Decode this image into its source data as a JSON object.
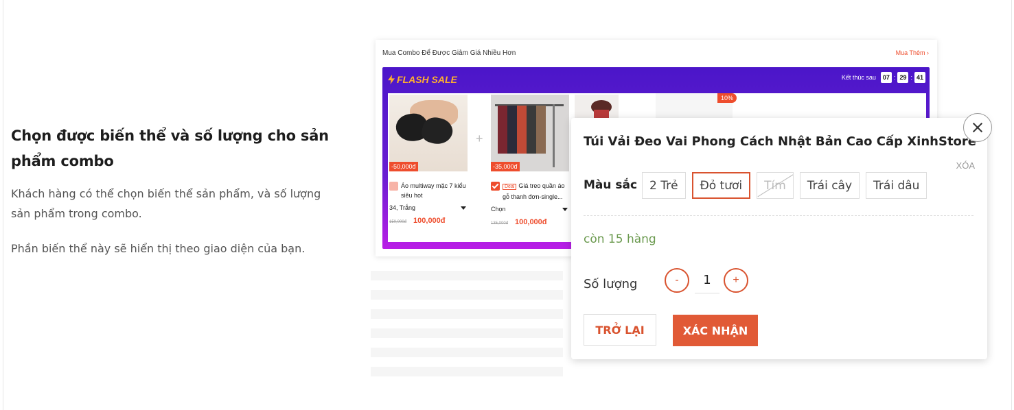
{
  "left": {
    "heading": "Chọn được biến thể và số lượng cho sản phẩm combo",
    "para1": "Khách hàng có thể chọn biến thể sản phẩm, và số lượng sản phẩm trong combo.",
    "para2": "Phần biến thể này sẽ hiển thị theo giao diện của bạn."
  },
  "combo": {
    "header": "Mua Combo Để Được Giảm Giá Nhiều Hơn",
    "more": "Mua Thêm ›",
    "flash_title": "FLASH SALE",
    "timer_label": "Kết thúc sau",
    "timer": [
      "07",
      "29",
      "41"
    ],
    "items": [
      {
        "badge": "-50,000đ",
        "name": "Áo multiway mặc 7 kiểu siêu hot",
        "variant": "34, Trắng",
        "old_price": "150,000đ",
        "price": "100,000đ",
        "checked": false
      },
      {
        "badge": "-35,000đ",
        "deal": "Deal",
        "name": "Giá treo quần áo gỗ thanh đơn-single...",
        "variant": "Chọn",
        "old_price": "135,000đ",
        "price": "100,000đ",
        "checked": true
      }
    ],
    "discount_tag": "10%"
  },
  "popup": {
    "title": "Túi Vải Đeo Vai Phong Cách Nhật Bản Cao Cấp XinhStore",
    "clear": "XÓA",
    "color_label": "Màu sắc",
    "options": [
      "2 Trẻ",
      "Đỏ tươi",
      "Tím",
      "Trái cây",
      "Trái dâu"
    ],
    "selected_option": "Đỏ tươi",
    "disabled_option": "Tím",
    "stock": "còn 15 hàng",
    "qty_label": "Số lượng",
    "minus": "-",
    "plus": "+",
    "qty": "1",
    "back": "TRỞ LẠI",
    "confirm": "XÁC NHẬN"
  },
  "colors": {
    "accent": "#ee4d2d",
    "flash_bg": "#4b16c9",
    "flash_text": "#ffb02e",
    "stock_green": "#6b9a4f"
  }
}
